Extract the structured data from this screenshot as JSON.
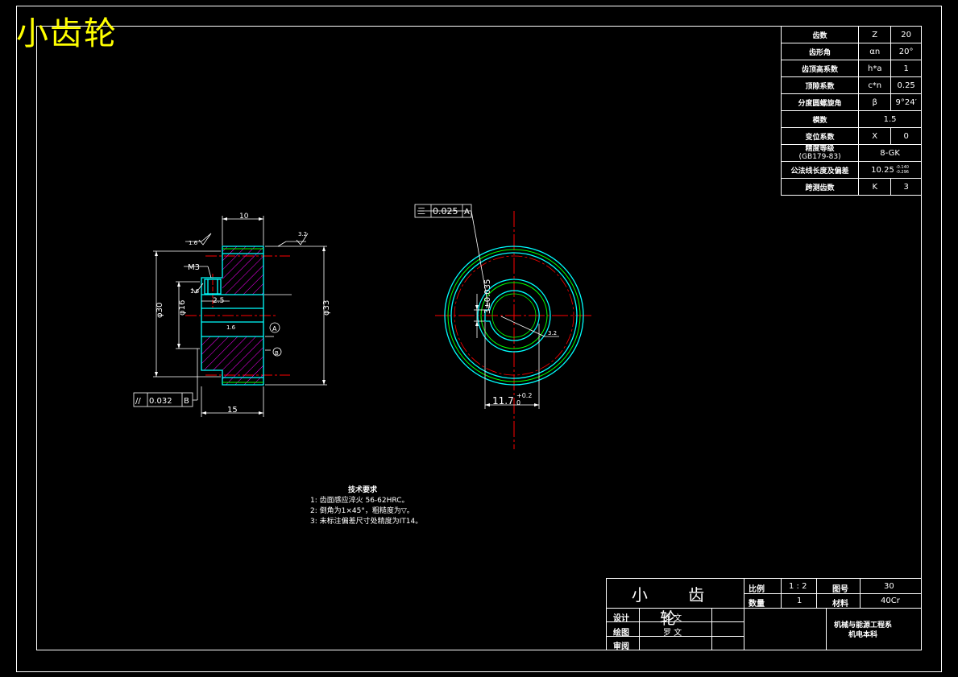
{
  "title": "小齿轮",
  "params": [
    {
      "label": "齿数",
      "symbol": "Z",
      "value": "20"
    },
    {
      "label": "齿形角",
      "symbol": "αn",
      "value": "20°"
    },
    {
      "label": "齿顶高系数",
      "symbol": "h*a",
      "value": "1"
    },
    {
      "label": "顶隙系数",
      "symbol": "c*n",
      "value": "0.25"
    },
    {
      "label": "分度圆螺旋角",
      "symbol": "β",
      "value": "9°24′"
    },
    {
      "label": "模数",
      "value_wide": "1.5"
    },
    {
      "label": "变位系数",
      "symbol": "X",
      "value": "0"
    },
    {
      "label": "精度等级",
      "label2": "(GB179-83)",
      "value_wide": "8-GK"
    },
    {
      "label": "公法线长度及偏差",
      "value_wide": "10.25",
      "tol_upper": "-0.140",
      "tol_lower": "-0.296"
    },
    {
      "label": "跨测齿数",
      "symbol": "K",
      "value": "3"
    }
  ],
  "left_view": {
    "dim_top": "10",
    "dim_bottom": "15",
    "dim_d30": "φ30",
    "dim_d16": "φ16",
    "dim_d33": "φ33",
    "m3": "M3",
    "d25": "2.5",
    "rough_16a": "1.6",
    "rough_32": "3.2",
    "rough_16b": "1.6",
    "rough_16c": "1.6",
    "datum_a": "A",
    "datum_b": "B",
    "parallel_tol": "0.032",
    "parallel_symbol": "//"
  },
  "right_view": {
    "sym_tol": "0.025",
    "sym_symbol": "三",
    "sym_datum": "A",
    "keyway_width": "3±0.035",
    "keyway_depth": "11.7",
    "keyway_depth_tol_up": "+0.2",
    "keyway_depth_tol_low": "0",
    "rough_32": "3.2"
  },
  "tech_req": {
    "heading": "技术要求",
    "lines": [
      "1: 齿面感应淬火 56-62HRC。",
      "2: 倒角为1×45°，粗糙度为▽。",
      "3: 未标注偏差尺寸处精度为IT14。"
    ]
  },
  "title_block": {
    "name": "小 齿 轮",
    "scale_label": "比例",
    "scale_value": "1 : 2",
    "drawing_no_label": "图号",
    "drawing_no_value": "30",
    "qty_label": "数量",
    "qty_value": "1",
    "material_label": "材料",
    "material_value": "40Cr",
    "design_label": "设计",
    "design_name": "罗 文",
    "drawn_label": "绘图",
    "drawn_name": "罗 文",
    "review_label": "审阅",
    "dept_line1": "机械与能源工程系",
    "dept_line2": "机电本科"
  }
}
